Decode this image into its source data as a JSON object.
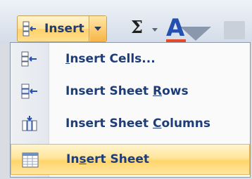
{
  "ribbon": {
    "insert_button": {
      "label": "Insert",
      "icon": "insert-cells-icon"
    },
    "autosum": {
      "symbol": "Σ",
      "icon": "sigma-icon"
    },
    "sort_filter": {
      "letter": "A",
      "icon": "sort-filter-icon"
    }
  },
  "menu": {
    "items": [
      {
        "label": "Insert Cells...",
        "access_key": "I",
        "icon": "insert-cells-icon",
        "highlighted": false
      },
      {
        "label": "Insert Sheet Rows",
        "access_key": "R",
        "icon": "insert-rows-icon",
        "highlighted": false
      },
      {
        "label": "Insert Sheet Columns",
        "access_key": "C",
        "icon": "insert-columns-icon",
        "highlighted": false
      },
      {
        "label": "Insert Sheet",
        "access_key": "S",
        "icon": "insert-sheet-icon",
        "highlighted": true
      }
    ]
  },
  "colors": {
    "highlight": "#ffd56b",
    "label_text": "#1d3d7a",
    "ribbon_bg": "#dfe6ef"
  }
}
